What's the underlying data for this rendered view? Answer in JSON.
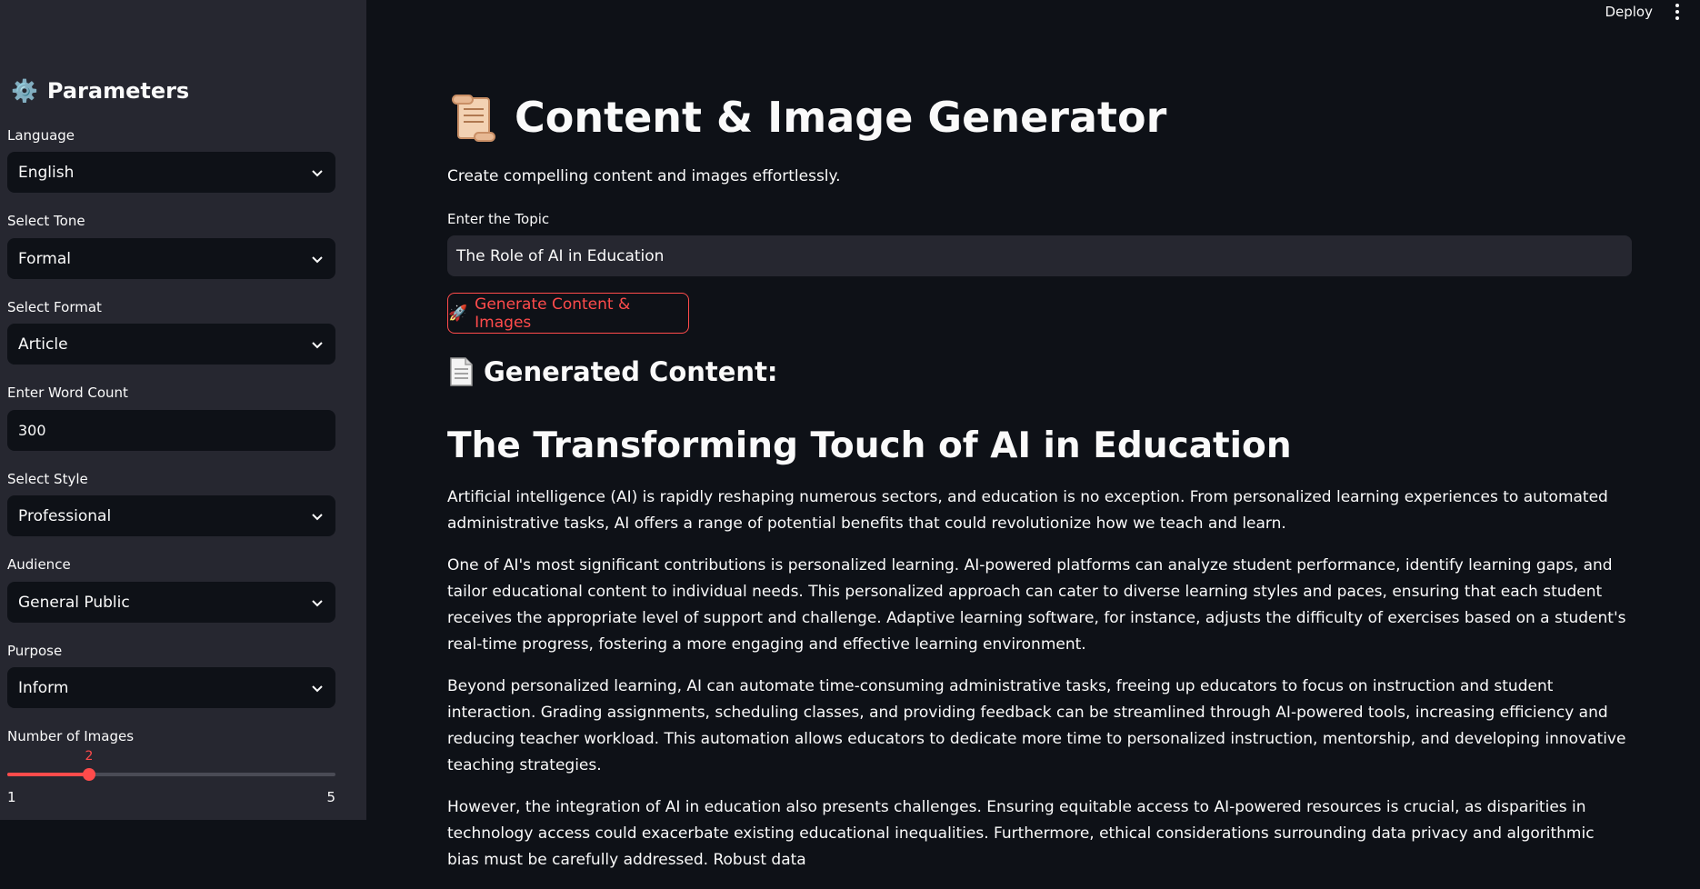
{
  "topbar": {
    "deploy_label": "Deploy"
  },
  "sidebar": {
    "title": "Parameters",
    "language": {
      "label": "Language",
      "value": "English"
    },
    "tone": {
      "label": "Select Tone",
      "value": "Formal"
    },
    "format": {
      "label": "Select Format",
      "value": "Article"
    },
    "word_count": {
      "label": "Enter Word Count",
      "value": "300"
    },
    "style": {
      "label": "Select Style",
      "value": "Professional"
    },
    "audience": {
      "label": "Audience",
      "value": "General Public"
    },
    "purpose": {
      "label": "Purpose",
      "value": "Inform"
    },
    "images": {
      "label": "Number of Images",
      "value": "2",
      "min": "1",
      "max": "5",
      "fraction": 0.25
    }
  },
  "main": {
    "title": "Content & Image Generator",
    "subtitle": "Create compelling content and images effortlessly.",
    "topic_label": "Enter the Topic",
    "topic_value": "The Role of AI in Education",
    "generate_label": "Generate Content & Images",
    "generated_heading": "Generated Content:",
    "article_title": "The Transforming Touch of AI in Education",
    "paragraphs": [
      "Artificial intelligence (AI) is rapidly reshaping numerous sectors, and education is no exception. From personalized learning experiences to automated administrative tasks, AI offers a range of potential benefits that could revolutionize how we teach and learn.",
      "One of AI's most significant contributions is personalized learning. AI-powered platforms can analyze student performance, identify learning gaps, and tailor educational content to individual needs. This personalized approach can cater to diverse learning styles and paces, ensuring that each student receives the appropriate level of support and challenge. Adaptive learning software, for instance, adjusts the difficulty of exercises based on a student's real-time progress, fostering a more engaging and effective learning environment.",
      "Beyond personalized learning, AI can automate time-consuming administrative tasks, freeing up educators to focus on instruction and student interaction. Grading assignments, scheduling classes, and providing feedback can be streamlined through AI-powered tools, increasing efficiency and reducing teacher workload. This automation allows educators to dedicate more time to personalized instruction, mentorship, and developing innovative teaching strategies.",
      "However, the integration of AI in education also presents challenges. Ensuring equitable access to AI-powered resources is crucial, as disparities in technology access could exacerbate existing educational inequalities. Furthermore, ethical considerations surrounding data privacy and algorithmic bias must be carefully addressed. Robust data"
    ]
  },
  "colors": {
    "accent": "#ff4b4b",
    "sidebar_bg": "#262730",
    "main_bg": "#0e1117"
  },
  "icons": {
    "sidebar_title": "gear-icon",
    "title": "scroll-icon",
    "generate": "rocket-icon",
    "generated": "document-icon",
    "select": "chevron-down-icon",
    "menu": "kebab-menu-icon"
  }
}
